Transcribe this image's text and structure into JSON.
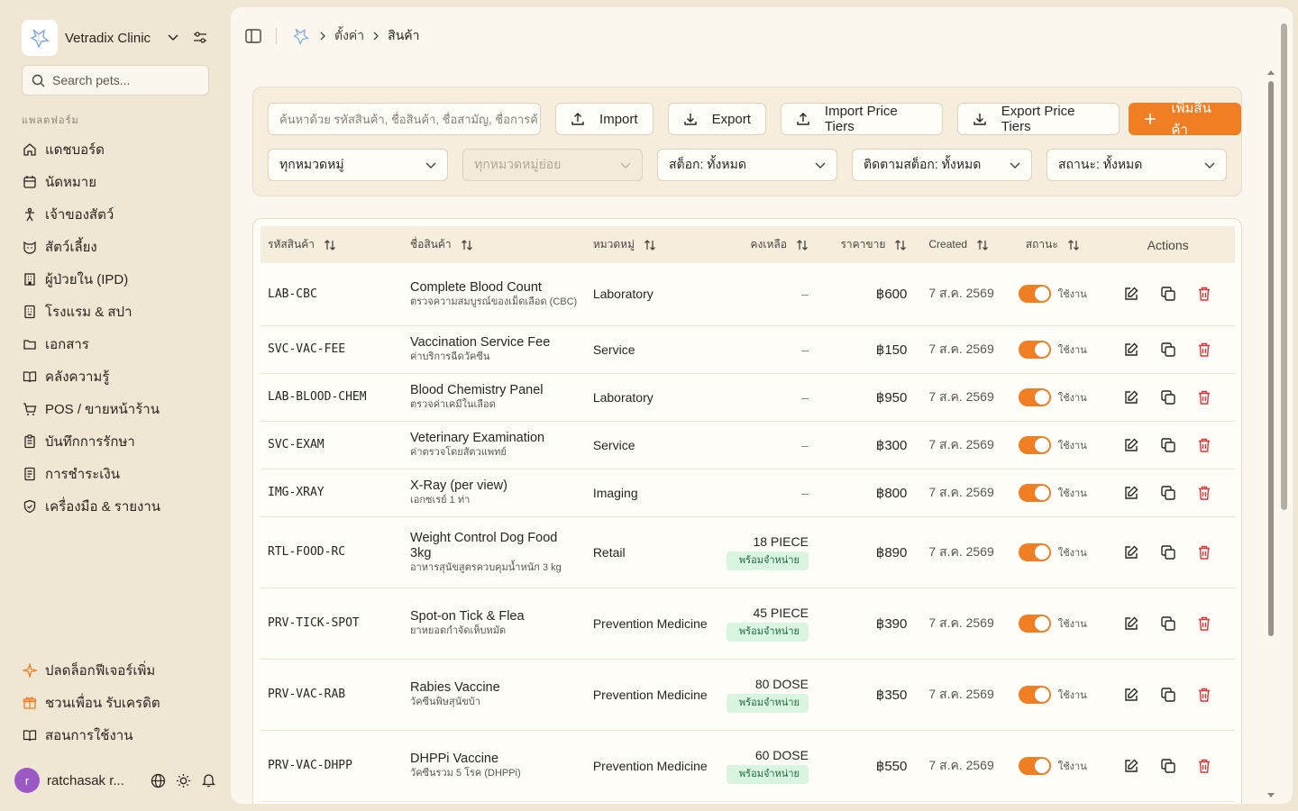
{
  "sidebar": {
    "clinic_name": "Vetradix Clinic",
    "search_placeholder": "Search pets...",
    "section_label": "แพลตฟอร์ม",
    "items": [
      {
        "label": "แดชบอร์ด",
        "icon": "home-icon"
      },
      {
        "label": "นัดหมาย",
        "icon": "calendar-icon"
      },
      {
        "label": "เจ้าของสัตว์",
        "icon": "person-icon"
      },
      {
        "label": "สัตว์เลี้ยง",
        "icon": "pet-icon"
      },
      {
        "label": "ผู้ป่วยใน (IPD)",
        "icon": "building-icon"
      },
      {
        "label": "โรงแรม & สปา",
        "icon": "hotel-icon"
      },
      {
        "label": "เอกสาร",
        "icon": "folder-icon"
      },
      {
        "label": "คลังความรู้",
        "icon": "book-icon"
      },
      {
        "label": "POS / ขายหน้าร้าน",
        "icon": "cart-icon"
      },
      {
        "label": "บันทึกการรักษา",
        "icon": "clipboard-icon"
      },
      {
        "label": "การชำระเงิน",
        "icon": "receipt-icon"
      },
      {
        "label": "เครื่องมือ & รายงาน",
        "icon": "shield-icon"
      }
    ],
    "bottom_items": [
      {
        "label": "ปลดล็อกฟีเจอร์เพิ่ม",
        "icon": "sparkle-icon"
      },
      {
        "label": "ชวนเพื่อน รับเครดิต",
        "icon": "gift-icon"
      },
      {
        "label": "สอนการใช้งาน",
        "icon": "book-icon"
      }
    ],
    "user": {
      "initial": "r",
      "name": "ratchasak r..."
    }
  },
  "breadcrumb": {
    "settings": "ตั้งค่า",
    "current": "สินค้า"
  },
  "toolbar": {
    "search_placeholder": "ค้นหาด้วย รหัสสินค้า, ชื่อสินค้า, ชื่อสามัญ, ชื่อการค้",
    "import_label": "Import",
    "export_label": "Export",
    "import_tiers_label": "Import Price Tiers",
    "export_tiers_label": "Export Price Tiers",
    "add_label": "เพิ่มสินค้า"
  },
  "filters": {
    "category": "ทุกหมวดหมู่",
    "subcategory": "ทุกหมวดหมู่ย่อย",
    "stock": "สต็อก: ทั้งหมด",
    "tracking": "ติดตามสต็อก: ทั้งหมด",
    "status": "สถานะ: ทั้งหมด"
  },
  "table": {
    "headers": {
      "code": "รหัสสินค้า",
      "name": "ชื่อสินค้า",
      "category": "หมวดหมู่",
      "stock": "คงเหลือ",
      "price": "ราคาขาย",
      "created": "Created",
      "status": "สถานะ",
      "actions": "Actions"
    },
    "rows": [
      {
        "code": "LAB-CBC",
        "name": "Complete Blood Count",
        "sub": "ตรวจความสมบูรณ์ของเม็ดเลือด (CBC)",
        "category": "Laboratory",
        "stock": "–",
        "badge": "",
        "price": "฿600",
        "created": "7 ส.ค. 2569",
        "status": "ใช้งาน"
      },
      {
        "code": "SVC-VAC-FEE",
        "name": "Vaccination Service Fee",
        "sub": "ค่าบริการฉีดวัคซีน",
        "category": "Service",
        "stock": "–",
        "badge": "",
        "price": "฿150",
        "created": "7 ส.ค. 2569",
        "status": "ใช้งาน"
      },
      {
        "code": "LAB-BLOOD-CHEM",
        "name": "Blood Chemistry Panel",
        "sub": "ตรวจค่าเคมีในเลือด",
        "category": "Laboratory",
        "stock": "–",
        "badge": "",
        "price": "฿950",
        "created": "7 ส.ค. 2569",
        "status": "ใช้งาน"
      },
      {
        "code": "SVC-EXAM",
        "name": "Veterinary Examination",
        "sub": "ค่าตรวจโดยสัตวแพทย์",
        "category": "Service",
        "stock": "–",
        "badge": "",
        "price": "฿300",
        "created": "7 ส.ค. 2569",
        "status": "ใช้งาน"
      },
      {
        "code": "IMG-XRAY",
        "name": "X-Ray (per view)",
        "sub": "เอกซเรย์ 1 ท่า",
        "category": "Imaging",
        "stock": "–",
        "badge": "",
        "price": "฿800",
        "created": "7 ส.ค. 2569",
        "status": "ใช้งาน"
      },
      {
        "code": "RTL-FOOD-RC",
        "name": "Weight Control Dog Food 3kg",
        "sub": "อาหารสุนัขสูตรควบคุมน้ำหนัก 3 kg",
        "category": "Retail",
        "stock": "18 PIECE",
        "badge": "พร้อมจำหน่าย",
        "price": "฿890",
        "created": "7 ส.ค. 2569",
        "status": "ใช้งาน"
      },
      {
        "code": "PRV-TICK-SPOT",
        "name": "Spot-on Tick & Flea",
        "sub": "ยาหยอดกำจัดเห็บหมัด",
        "category": "Prevention Medicine",
        "stock": "45 PIECE",
        "badge": "พร้อมจำหน่าย",
        "price": "฿390",
        "created": "7 ส.ค. 2569",
        "status": "ใช้งาน"
      },
      {
        "code": "PRV-VAC-RAB",
        "name": "Rabies Vaccine",
        "sub": "วัคซีนพิษสุนัขบ้า",
        "category": "Prevention Medicine",
        "stock": "80 DOSE",
        "badge": "พร้อมจำหน่าย",
        "price": "฿350",
        "created": "7 ส.ค. 2569",
        "status": "ใช้งาน"
      },
      {
        "code": "PRV-VAC-DHPP",
        "name": "DHPPi Vaccine",
        "sub": "วัคซีนรวม 5 โรค (DHPPi)",
        "category": "Prevention Medicine",
        "stock": "60 DOSE",
        "badge": "พร้อมจำหน่าย",
        "price": "฿550",
        "created": "7 ส.ค. 2569",
        "status": "ใช้งาน"
      }
    ]
  },
  "colors": {
    "accent": "#f07f24",
    "badge_bg": "#d9f5e2",
    "delete": "#e0343a"
  }
}
